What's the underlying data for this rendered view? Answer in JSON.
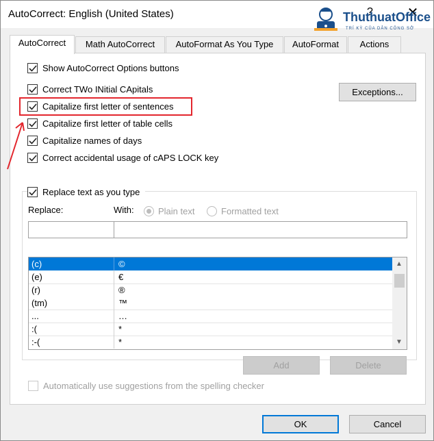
{
  "window": {
    "title": "AutoCorrect: English (United States)",
    "help": "?",
    "close": "✕"
  },
  "logo": {
    "name": "ThuthuatOffice",
    "tagline": "TRÍ KỲ CỦA DÂN CÔNG SỞ"
  },
  "tabs": [
    {
      "label": "AutoCorrect",
      "active": true
    },
    {
      "label": "Math AutoCorrect",
      "active": false
    },
    {
      "label": "AutoFormat As You Type",
      "active": false
    },
    {
      "label": "AutoFormat",
      "active": false
    },
    {
      "label": "Actions",
      "active": false
    }
  ],
  "options": {
    "show_buttons": "Show AutoCorrect Options buttons",
    "correct_two": "Correct TWo INitial CApitals",
    "cap_sentences": "Capitalize first letter of sentences",
    "cap_table": "Capitalize first letter of table cells",
    "cap_days": "Capitalize names of days",
    "caps_lock": "Correct accidental usage of cAPS LOCK key",
    "replace_text": "Replace text as you type"
  },
  "exceptions_label": "Exceptions...",
  "replace": {
    "replace_label": "Replace:",
    "with_label": "With:",
    "plain_text": "Plain text",
    "formatted_text": "Formatted text",
    "replace_value": "",
    "with_value": ""
  },
  "entries": [
    {
      "from": "(c)",
      "to": "©"
    },
    {
      "from": "(e)",
      "to": "€"
    },
    {
      "from": "(r)",
      "to": "®"
    },
    {
      "from": "(tm)",
      "to": "™"
    },
    {
      "from": "...",
      "to": "…"
    },
    {
      "from": ":(",
      "to": "*"
    },
    {
      "from": ":-(",
      "to": "*"
    }
  ],
  "buttons": {
    "add": "Add",
    "delete": "Delete",
    "ok": "OK",
    "cancel": "Cancel"
  },
  "suggestions": "Automatically use suggestions from the spelling checker",
  "colors": {
    "accent": "#0078d7",
    "highlight": "#e3262d",
    "brand": "#1a4f8b"
  }
}
